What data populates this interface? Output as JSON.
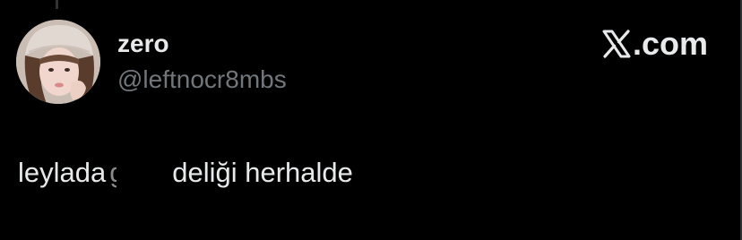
{
  "author": {
    "display_name": "zero",
    "handle": "@leftnocr8mbs"
  },
  "brand": {
    "icon": "x-logo-icon",
    "label": ".com"
  },
  "tweet": {
    "text_before": "leylada",
    "redacted_glyph": "g",
    "text_after": "deliği herhalde"
  },
  "colors": {
    "background": "#000000",
    "primary_text": "#e7e9ea",
    "secondary_text": "#71767b"
  }
}
